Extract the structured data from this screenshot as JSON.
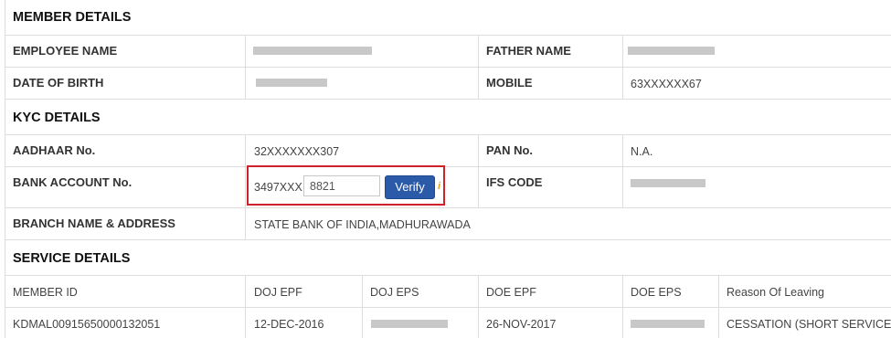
{
  "member_details": {
    "title": "MEMBER DETAILS",
    "employee_name_label": "EMPLOYEE NAME",
    "father_name_label": "FATHER NAME",
    "dob_label": "DATE OF BIRTH",
    "mobile_label": "MOBILE",
    "mobile_value": "63XXXXXX67"
  },
  "kyc_details": {
    "title": "KYC DETAILS",
    "aadhaar_label": "AADHAAR No.",
    "aadhaar_value": "32XXXXXXX307",
    "pan_label": "PAN No.",
    "pan_value": "N.A.",
    "bank_account_label": "BANK ACCOUNT No.",
    "bank_account_prefix": "3497XXX",
    "bank_account_input_value": "8821",
    "verify_label": "Verify",
    "info_icon": "info-icon",
    "ifs_label": "IFS CODE",
    "branch_label": "BRANCH NAME & ADDRESS",
    "branch_value": "STATE BANK OF INDIA,MADHURAWADA"
  },
  "service_details": {
    "title": "SERVICE DETAILS",
    "columns": [
      "MEMBER ID",
      "DOJ EPF",
      "DOJ EPS",
      "DOE EPF",
      "DOE EPS",
      "Reason Of Leaving"
    ],
    "rows": [
      {
        "member_id": "KDMAL00915650000132051",
        "doj_epf": "12-DEC-2016",
        "doe_epf": "26-NOV-2017",
        "reason": "CESSATION (SHORT SERVICE)"
      }
    ]
  },
  "colors": {
    "border": "#dddddd",
    "highlight": "#d0202a",
    "button": "#2a5aa8",
    "mask": "#c8c8c8"
  }
}
